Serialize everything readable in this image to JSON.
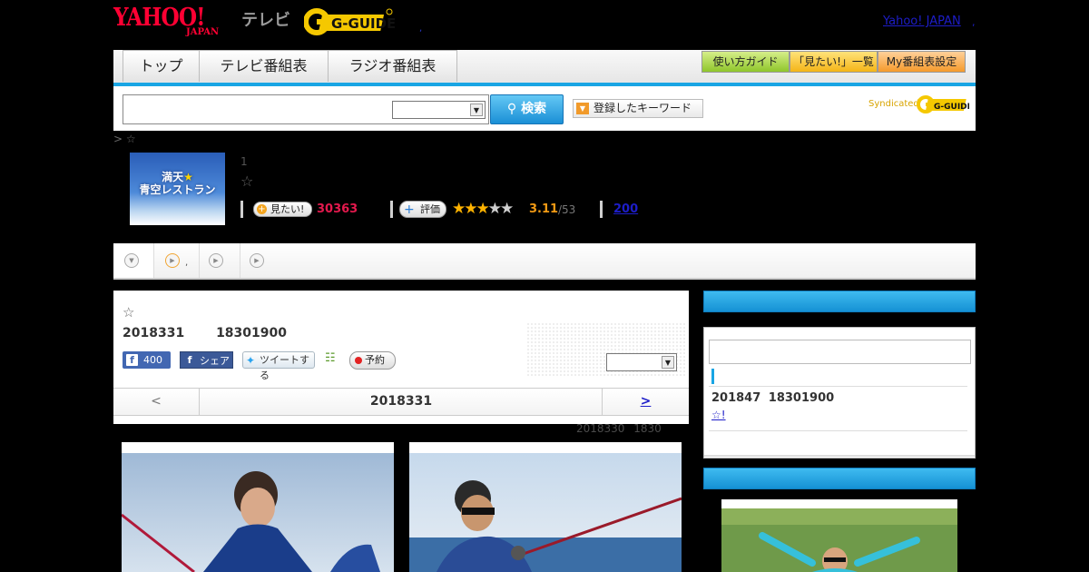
{
  "header": {
    "yahoo_logo_main": "YAHOO!",
    "yahoo_logo_sub": "JAPAN",
    "service_name": "テレビ",
    "gguide_logo": "G-GUIDE",
    "separator": ",",
    "yahoo_japan_link": "Yahoo! JAPAN",
    "yahoo_japan_comma": ","
  },
  "nav": {
    "tabs": [
      {
        "label": "トップ"
      },
      {
        "label": "テレビ番組表"
      },
      {
        "label": "ラジオ番組表"
      }
    ],
    "guide_button": "使い方ガイド",
    "mitai_list_button": "「見たい!」一覧",
    "my_settings_button": "My番組表設定"
  },
  "search": {
    "input_value": "",
    "select_value": "",
    "search_button": "検索",
    "keyword_button": "登録したキーワード",
    "syndicated_label": "Syndicated",
    "syndicated_logo": "G-GUIDE"
  },
  "breadcrumb": {
    "text": "> ☆"
  },
  "program": {
    "thumb_line1": "満天",
    "thumb_star": "★",
    "thumb_line2": "青空レストラン",
    "number": "1",
    "title_star": "☆",
    "mitai_button": "見たい!",
    "mitai_count": "30363",
    "review_button": "評価",
    "rating_stars": 3,
    "rating_value": "3.11",
    "rating_count": "/53",
    "reviews_link": "200"
  },
  "subtabs": {
    "item2_dot": ","
  },
  "episode": {
    "star": "☆",
    "date_time": "2018331 18301900",
    "fb_like_count": "400",
    "fb_share_label": "シェア",
    "tweet_label": "ツイートする",
    "reserve_label": "予約",
    "channel_select_value": "",
    "nav_prev": "<",
    "nav_current": "2018331",
    "nav_next": ">",
    "updated_text": "2018330 1830"
  },
  "sidebar": {
    "box_input_value": "",
    "next_date": "201847 18301900",
    "next_link": "☆!"
  },
  "colors": {
    "accent_blue": "#19a5e4",
    "yahoo_red": "#ff0033",
    "gguide_yellow": "#f5c800",
    "count_red": "#e3194d",
    "rating_orange": "#f29a14",
    "link_blue": "#1d1dc9"
  }
}
